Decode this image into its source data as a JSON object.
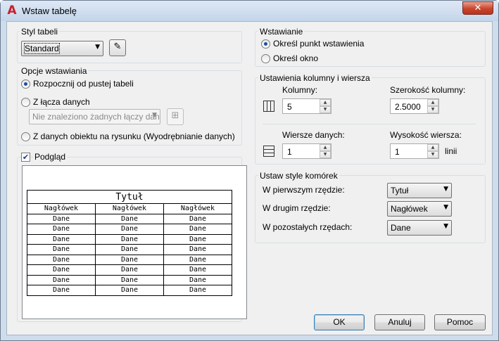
{
  "window": {
    "title": "Wstaw tabelę",
    "close_glyph": "✕"
  },
  "table_style": {
    "legend": "Styl tabeli",
    "selected": "Standard"
  },
  "insert_options": {
    "legend": "Opcje wstawiania",
    "option_empty": "Rozpocznij od pustej tabeli",
    "option_data_link": "Z łącza danych",
    "data_link_placeholder": "Nie znaleziono żadnych łączy danych",
    "option_object_data": "Z danych obiektu na rysunku (Wyodrębnianie danych)"
  },
  "preview": {
    "label": "Podgląd",
    "title": "Tytuł",
    "headers": [
      "Nagłówek",
      "Nagłówek",
      "Nagłówek"
    ],
    "rows": [
      [
        "Dane",
        "Dane",
        "Dane"
      ],
      [
        "Dane",
        "Dane",
        "Dane"
      ],
      [
        "Dane",
        "Dane",
        "Dane"
      ],
      [
        "Dane",
        "Dane",
        "Dane"
      ],
      [
        "Dane",
        "Dane",
        "Dane"
      ],
      [
        "Dane",
        "Dane",
        "Dane"
      ],
      [
        "Dane",
        "Dane",
        "Dane"
      ],
      [
        "Dane",
        "Dane",
        "Dane"
      ]
    ]
  },
  "insertion": {
    "legend": "Wstawianie",
    "option_point": "Określ punkt wstawienia",
    "option_window": "Określ okno"
  },
  "column_row_settings": {
    "legend": "Ustawienia kolumny i wiersza",
    "columns_label": "Kolumny:",
    "columns_value": "5",
    "column_width_label": "Szerokość kolumny:",
    "column_width_value": "2.5000",
    "data_rows_label": "Wiersze danych:",
    "data_rows_value": "1",
    "row_height_label": "Wysokość wiersza:",
    "row_height_value": "1",
    "row_height_unit": "linii"
  },
  "cell_styles": {
    "legend": "Ustaw style komórek",
    "first_row_label": "W pierwszym rzędzie:",
    "first_row_value": "Tytuł",
    "second_row_label": "W drugim rzędzie:",
    "second_row_value": "Nagłówek",
    "other_rows_label": "W pozostałych rzędach:",
    "other_rows_value": "Dane"
  },
  "buttons": {
    "ok": "OK",
    "cancel": "Anuluj",
    "help": "Pomoc"
  }
}
